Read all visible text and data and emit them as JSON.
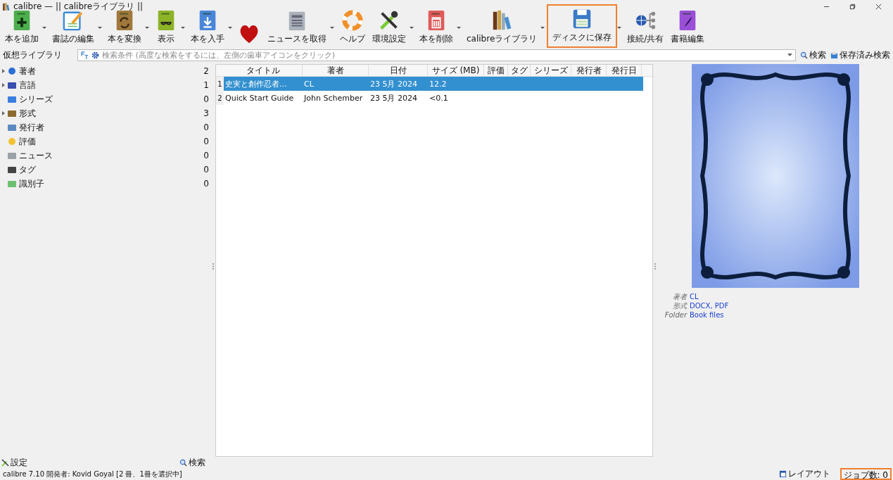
{
  "window": {
    "title": "calibre — || calibreライブラリ ||"
  },
  "toolbar": [
    {
      "kind": "add",
      "label": "本を追加",
      "dropdown": true,
      "highlighted": false
    },
    {
      "kind": "edit",
      "label": "書誌の編集",
      "dropdown": true,
      "highlighted": false
    },
    {
      "kind": "convert",
      "label": "本を変換",
      "dropdown": true,
      "highlighted": false
    },
    {
      "kind": "view",
      "label": "表示",
      "dropdown": true,
      "highlighted": false
    },
    {
      "kind": "get",
      "label": "本を入手",
      "dropdown": true,
      "highlighted": false
    },
    {
      "kind": "donate",
      "dropdown": false,
      "highlighted": false
    },
    {
      "kind": "news",
      "label": "ニュースを取得",
      "dropdown": true,
      "highlighted": false
    },
    {
      "kind": "help",
      "label": "ヘルプ",
      "dropdown": false,
      "highlighted": false
    },
    {
      "kind": "prefs",
      "label": "環境設定",
      "dropdown": true,
      "highlighted": false
    },
    {
      "kind": "remove",
      "label": "本を削除",
      "dropdown": true,
      "highlighted": false
    },
    {
      "kind": "library",
      "label": "calibreライブラリ",
      "dropdown": true,
      "highlighted": false
    },
    {
      "kind": "save",
      "label": "ディスクに保存",
      "dropdown": true,
      "highlighted": true
    },
    {
      "kind": "connect",
      "label": "接続/共有",
      "dropdown": false,
      "highlighted": false
    },
    {
      "kind": "ebook",
      "label": "書籍編集",
      "dropdown": false,
      "highlighted": false
    }
  ],
  "search_bar": {
    "virtual_library": "仮想ライブラリ",
    "placeholder": "検索条件 (高度な検索をするには、左側の歯車アイコンをクリック)",
    "search": "検索",
    "saved_searches": "保存済み検索"
  },
  "tag_browser": [
    {
      "kind": "authors",
      "label": "著者",
      "count": "2",
      "expandable": true
    },
    {
      "kind": "languages",
      "label": "言語",
      "count": "1",
      "expandable": true
    },
    {
      "kind": "series",
      "label": "シリーズ",
      "count": "0",
      "expandable": false
    },
    {
      "kind": "formats",
      "label": "形式",
      "count": "3",
      "expandable": true
    },
    {
      "kind": "publisher",
      "label": "発行者",
      "count": "0",
      "expandable": false
    },
    {
      "kind": "rating",
      "label": "評価",
      "count": "0",
      "expandable": false
    },
    {
      "kind": "news",
      "label": "ニュース",
      "count": "0",
      "expandable": false
    },
    {
      "kind": "tags",
      "label": "タグ",
      "count": "0",
      "expandable": false
    },
    {
      "kind": "identifiers",
      "label": "識別子",
      "count": "0",
      "expandable": false
    }
  ],
  "tag_browser_footer": {
    "settings": "設定",
    "search": "検索"
  },
  "table": {
    "columns": [
      "タイトル",
      "著者",
      "日付",
      "サイズ (MB)",
      "評価",
      "タグ",
      "シリーズ",
      "発行者",
      "発行日"
    ],
    "rows": [
      {
        "number": "1",
        "selected": true,
        "cells": [
          "史実と創作忍者...",
          "CL",
          "23 5月 2024",
          "12.2",
          "",
          "",
          "",
          "",
          ""
        ]
      },
      {
        "number": "2",
        "selected": false,
        "cells": [
          "Quick Start Guide",
          "John Schember",
          "23 5月 2024",
          "<0.1",
          "",
          "",
          "",
          "",
          ""
        ]
      }
    ]
  },
  "details": [
    {
      "label": "著者",
      "value": "CL"
    },
    {
      "label": "形式",
      "value": "DOCX, PDF"
    },
    {
      "label": "Folder",
      "value": "Book files"
    }
  ],
  "status_bar": {
    "text": "calibre 7.10 開発者: Kovid Goyal   [2 冊、1冊を選択中]",
    "layout": "レイアウト",
    "jobs": "ジョブ数: 0",
    "jobs_highlighted": true
  }
}
